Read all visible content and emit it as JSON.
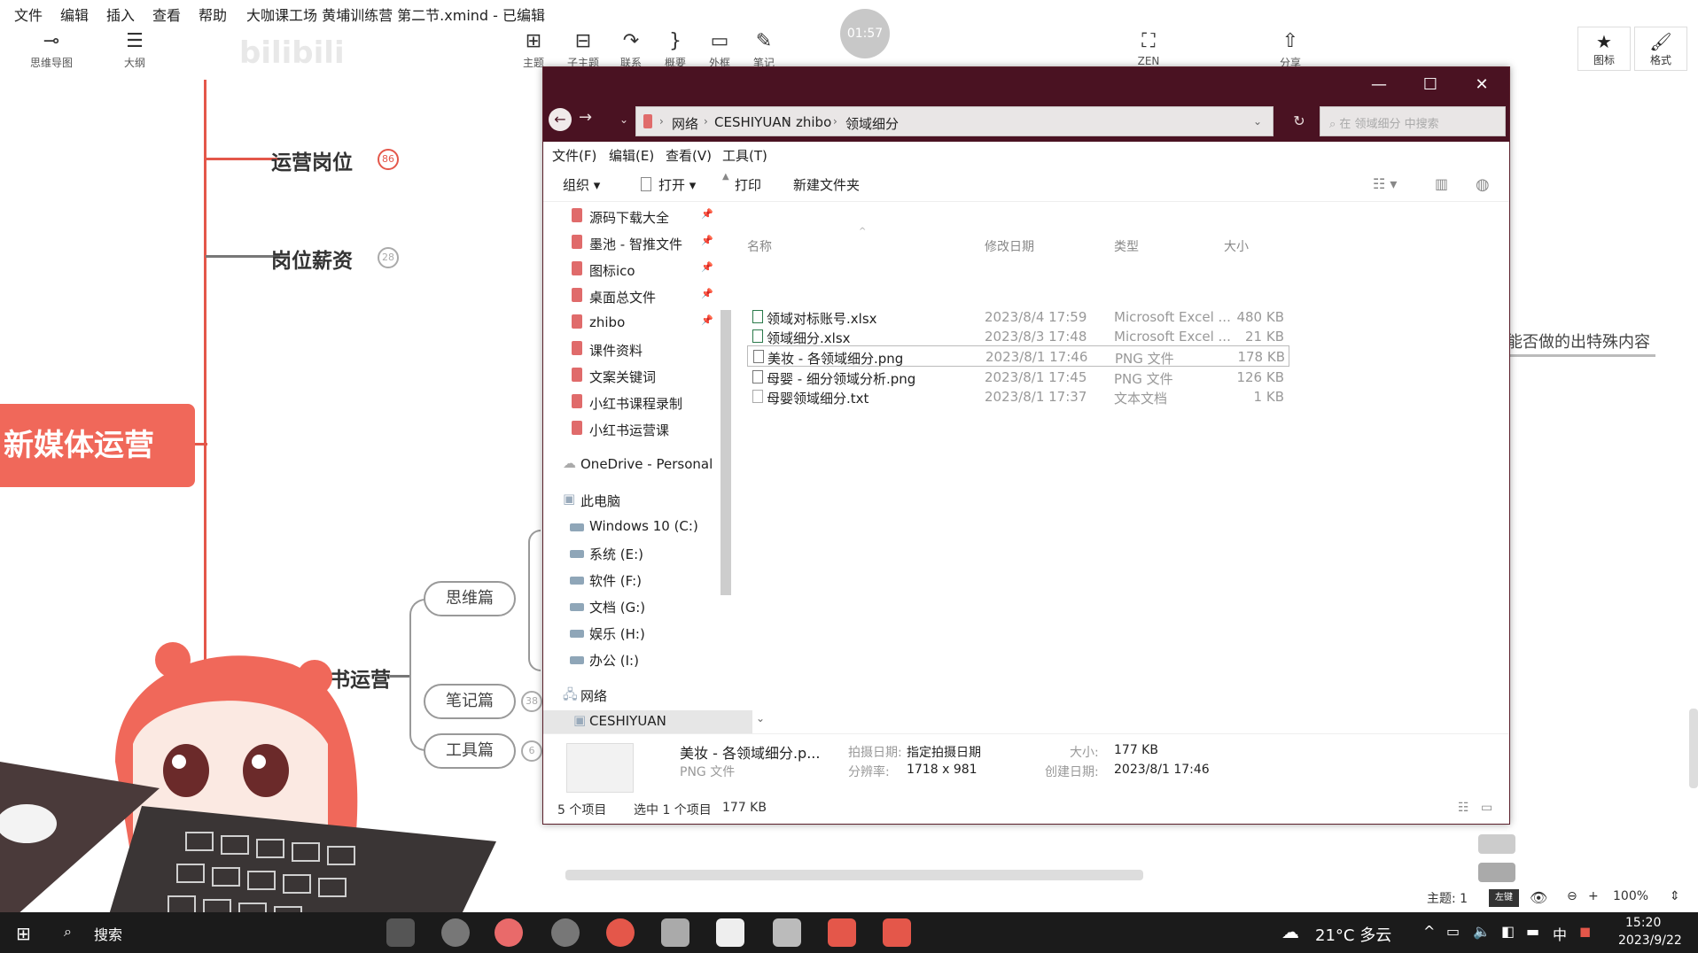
{
  "menubar": {
    "items": [
      "文件",
      "编辑",
      "插入",
      "查看",
      "帮助"
    ],
    "title": "大咖课工场 黄埔训练营 第二节.xmind - 已编辑"
  },
  "toolbar": {
    "left": [
      {
        "label": "思维导图",
        "icon": "mindmap-icon"
      },
      {
        "label": "大纲",
        "icon": "outline-icon"
      }
    ],
    "center": [
      {
        "label": "主题",
        "icon": "topic-add-icon"
      },
      {
        "label": "子主题",
        "icon": "subtopic-add-icon"
      },
      {
        "label": "联系",
        "icon": "relationship-icon"
      },
      {
        "label": "概要",
        "icon": "summary-brace-icon"
      },
      {
        "label": "外框",
        "icon": "boundary-icon"
      },
      {
        "label": "笔记",
        "icon": "note-icon"
      }
    ],
    "timer": "01:57",
    "zen": "ZEN",
    "share": "分享",
    "right": [
      {
        "label": "图标",
        "icon": "star-icon"
      },
      {
        "label": "格式",
        "icon": "brush-icon"
      }
    ],
    "watermark": "bilibili"
  },
  "mindmap": {
    "root": "新媒体运营",
    "topics": [
      {
        "label": "运营岗位",
        "count": "86"
      },
      {
        "label": "岗位薪资",
        "count": "28"
      },
      {
        "label": "小红书运营",
        "count": ""
      }
    ],
    "subnodes": [
      {
        "label": "思维篇",
        "count": ""
      },
      {
        "label": "笔记篇",
        "count": "38"
      },
      {
        "label": "工具篇",
        "count": "6"
      }
    ],
    "side_text": "能否做的出特殊内容"
  },
  "explorer": {
    "breadcrumb": [
      "网络",
      "CESHIYUAN",
      "zhibo",
      "领域细分"
    ],
    "search_placeholder": "在 领域细分 中搜索",
    "menu": [
      "文件(F)",
      "编辑(E)",
      "查看(V)",
      "工具(T)"
    ],
    "commands": [
      "组织 ▾",
      "打开 ▾",
      "打印",
      "新建文件夹"
    ],
    "nav_items": [
      {
        "label": "源码下载大全",
        "type": "folder",
        "pinned": true
      },
      {
        "label": "墨池 - 智推文件",
        "type": "folder",
        "pinned": true
      },
      {
        "label": "图标ico",
        "type": "folder",
        "pinned": true
      },
      {
        "label": "桌面总文件",
        "type": "folder",
        "pinned": true
      },
      {
        "label": "zhibo",
        "type": "folder",
        "pinned": true
      },
      {
        "label": "课件资料",
        "type": "folder",
        "pinned": false
      },
      {
        "label": "文案关键词",
        "type": "folder",
        "pinned": false
      },
      {
        "label": "小红书课程录制",
        "type": "folder",
        "pinned": false
      },
      {
        "label": "小红书运营课",
        "type": "folder",
        "pinned": false
      },
      {
        "label": "OneDrive - Personal",
        "type": "cloud",
        "pinned": false
      },
      {
        "label": "此电脑",
        "type": "pc",
        "pinned": false
      },
      {
        "label": "Windows 10 (C:)",
        "type": "drive",
        "pinned": false
      },
      {
        "label": "系统 (E:)",
        "type": "drive",
        "pinned": false
      },
      {
        "label": "软件 (F:)",
        "type": "drive",
        "pinned": false
      },
      {
        "label": "文档 (G:)",
        "type": "drive",
        "pinned": false
      },
      {
        "label": "娱乐 (H:)",
        "type": "drive",
        "pinned": false
      },
      {
        "label": "办公 (I:)",
        "type": "drive",
        "pinned": false
      },
      {
        "label": "网络",
        "type": "network",
        "pinned": false
      },
      {
        "label": "CESHIYUAN",
        "type": "pc",
        "pinned": false
      }
    ],
    "columns": [
      "名称",
      "修改日期",
      "类型",
      "大小"
    ],
    "files": [
      {
        "name": "领域对标账号.xlsx",
        "date": "2023/8/4 17:59",
        "type": "Microsoft Excel ...",
        "size": "480 KB",
        "icon": "excel-file-icon"
      },
      {
        "name": "领域细分.xlsx",
        "date": "2023/8/3 17:48",
        "type": "Microsoft Excel ...",
        "size": "21 KB",
        "icon": "excel-file-icon"
      },
      {
        "name": "美妆 - 各领域细分.png",
        "date": "2023/8/1 17:46",
        "type": "PNG 文件",
        "size": "178 KB",
        "icon": "image-file-icon"
      },
      {
        "name": "母婴 - 细分领域分析.png",
        "date": "2023/8/1 17:45",
        "type": "PNG 文件",
        "size": "126 KB",
        "icon": "image-file-icon"
      },
      {
        "name": "母婴领域细分.txt",
        "date": "2023/8/1 17:37",
        "type": "文本文档",
        "size": "1 KB",
        "icon": "text-file-icon"
      }
    ],
    "selected_index": 2,
    "details": {
      "name": "美妆 - 各领域细分.p...",
      "type": "PNG 文件",
      "taken_label": "拍摄日期:",
      "taken_value": "指定拍摄日期",
      "res_label": "分辨率:",
      "res_value": "1718 x 981",
      "size_label": "大小:",
      "size_value": "177 KB",
      "created_label": "创建日期:",
      "created_value": "2023/8/1 17:46"
    },
    "status": {
      "count": "5 个项目",
      "selected": "选中 1 个项目",
      "size": "177 KB"
    }
  },
  "xmind_status": {
    "topics": "主题: 1",
    "zoom": "100%"
  },
  "taskbar": {
    "search": "搜索",
    "weather": "21°C 多云",
    "ime": "中",
    "time": "15:20",
    "date": "2023/9/22"
  }
}
